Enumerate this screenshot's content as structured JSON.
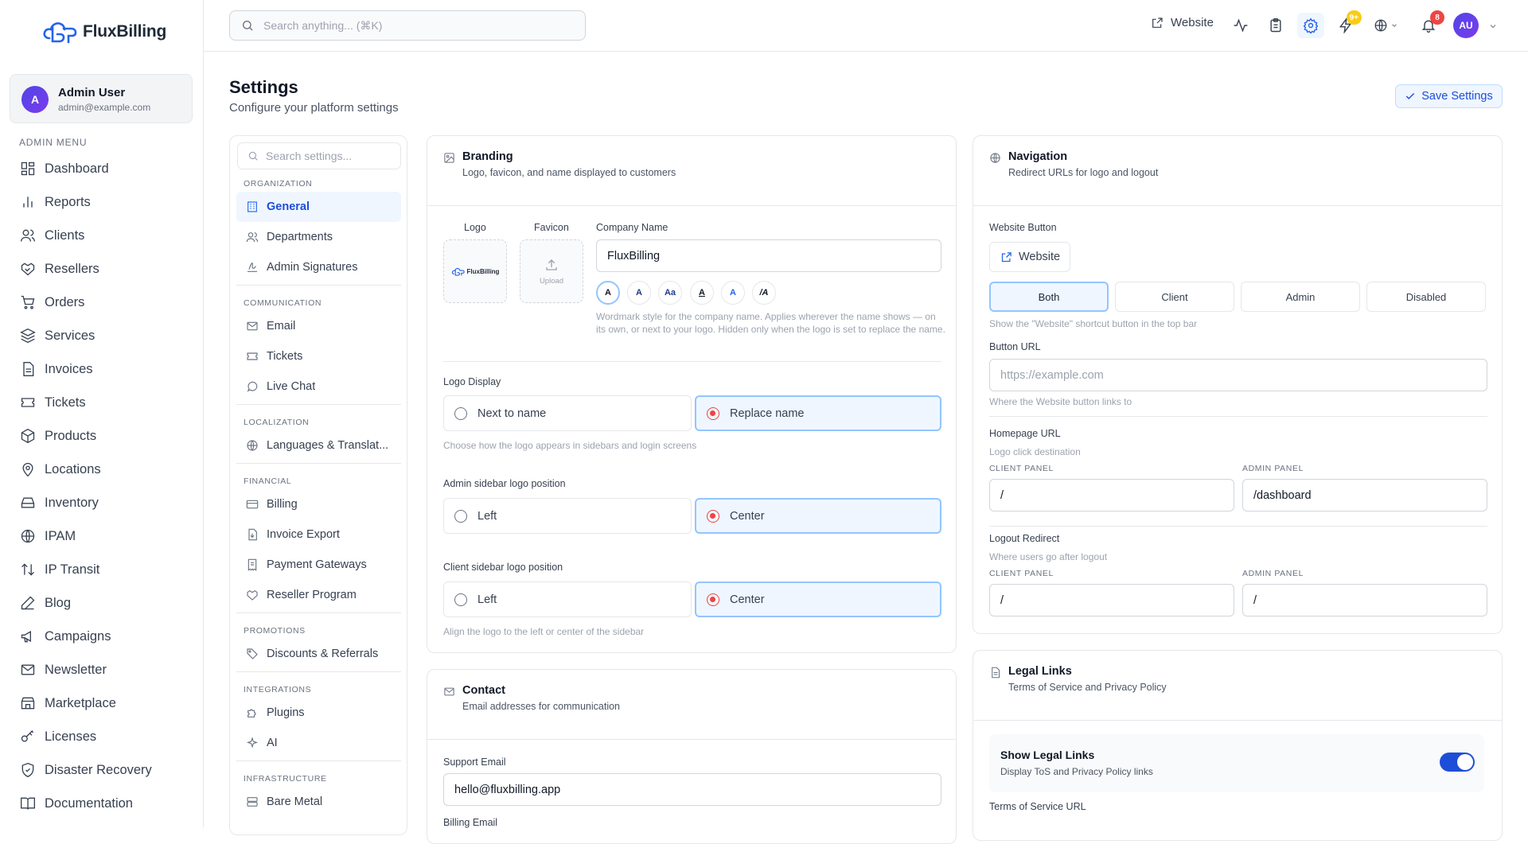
{
  "brand": {
    "name": "FluxBilling"
  },
  "user": {
    "initial": "A",
    "name": "Admin User",
    "email": "admin@example.com"
  },
  "menu": {
    "heading": "ADMIN MENU",
    "items": [
      {
        "label": "Dashboard",
        "icon": "dashboard-icon"
      },
      {
        "label": "Reports",
        "icon": "bar-chart-icon"
      },
      {
        "label": "Clients",
        "icon": "users-icon"
      },
      {
        "label": "Resellers",
        "icon": "handshake-icon"
      },
      {
        "label": "Orders",
        "icon": "cart-icon"
      },
      {
        "label": "Services",
        "icon": "layers-icon"
      },
      {
        "label": "Invoices",
        "icon": "file-icon"
      },
      {
        "label": "Tickets",
        "icon": "ticket-icon"
      },
      {
        "label": "Products",
        "icon": "box-icon"
      },
      {
        "label": "Locations",
        "icon": "map-pin-icon"
      },
      {
        "label": "Inventory",
        "icon": "hard-drive-icon"
      },
      {
        "label": "IPAM",
        "icon": "globe-icon"
      },
      {
        "label": "IP Transit",
        "icon": "arrows-updown-icon"
      },
      {
        "label": "Blog",
        "icon": "pen-icon"
      },
      {
        "label": "Campaigns",
        "icon": "megaphone-icon"
      },
      {
        "label": "Newsletter",
        "icon": "mail-icon"
      },
      {
        "label": "Marketplace",
        "icon": "store-icon"
      },
      {
        "label": "Licenses",
        "icon": "key-icon"
      },
      {
        "label": "Disaster Recovery",
        "icon": "shield-icon"
      },
      {
        "label": "Documentation",
        "icon": "book-icon"
      }
    ]
  },
  "topbar": {
    "search_placeholder": "Search anything... (⌘K)",
    "website_label": "Website",
    "updates_badge": "9+",
    "notifications_badge": "8",
    "avatar_initials": "AU"
  },
  "page": {
    "title": "Settings",
    "subtitle": "Configure your platform settings",
    "save_label": "Save Settings"
  },
  "settings_nav": {
    "search_placeholder": "Search settings...",
    "groups": [
      {
        "title": "ORGANIZATION",
        "items": [
          {
            "label": "General",
            "active": true
          },
          {
            "label": "Departments"
          },
          {
            "label": "Admin Signatures"
          }
        ]
      },
      {
        "title": "COMMUNICATION",
        "items": [
          {
            "label": "Email"
          },
          {
            "label": "Tickets"
          },
          {
            "label": "Live Chat"
          }
        ]
      },
      {
        "title": "LOCALIZATION",
        "items": [
          {
            "label": "Languages & Translat..."
          }
        ]
      },
      {
        "title": "FINANCIAL",
        "items": [
          {
            "label": "Billing"
          },
          {
            "label": "Invoice Export"
          },
          {
            "label": "Payment Gateways"
          },
          {
            "label": "Reseller Program"
          }
        ]
      },
      {
        "title": "PROMOTIONS",
        "items": [
          {
            "label": "Discounts & Referrals"
          }
        ]
      },
      {
        "title": "INTEGRATIONS",
        "items": [
          {
            "label": "Plugins"
          },
          {
            "label": "AI"
          }
        ]
      },
      {
        "title": "INFRASTRUCTURE",
        "items": [
          {
            "label": "Bare Metal"
          }
        ]
      }
    ]
  },
  "branding": {
    "title": "Branding",
    "description": "Logo, favicon, and name displayed to customers",
    "logo_label": "Logo",
    "logo_preview_text": "FluxBilling",
    "favicon_label": "Favicon",
    "upload_label": "Upload",
    "company_name_label": "Company Name",
    "company_name_value": "FluxBilling",
    "wordmark_styles": [
      "A",
      "A",
      "Aa",
      "A",
      "A",
      "/A"
    ],
    "wordmark_hint": "Wordmark style for the company name. Applies wherever the name shows — on its own, or next to your logo. Hidden only when the logo is set to replace the name.",
    "logo_display_label": "Logo Display",
    "logo_display_options": [
      "Next to name",
      "Replace name"
    ],
    "logo_display_hint": "Choose how the logo appears in sidebars and login screens",
    "admin_sidebar_label": "Admin sidebar logo position",
    "client_sidebar_label": "Client sidebar logo position",
    "position_options": [
      "Left",
      "Center"
    ],
    "position_hint": "Align the logo to the left or center of the sidebar"
  },
  "contact": {
    "title": "Contact",
    "description": "Email addresses for communication",
    "support_label": "Support Email",
    "support_value": "hello@fluxbilling.app",
    "billing_label": "Billing Email"
  },
  "navigation": {
    "title": "Navigation",
    "description": "Redirect URLs for logo and logout",
    "website_button_label": "Website Button",
    "website_button_text": "Website",
    "visibility_options": [
      "Both",
      "Client",
      "Admin",
      "Disabled"
    ],
    "visibility_hint": "Show the \"Website\" shortcut button in the top bar",
    "button_url_label": "Button URL",
    "button_url_placeholder": "https://example.com",
    "button_url_hint": "Where the Website button links to",
    "homepage_label": "Homepage URL",
    "homepage_hint": "Logo click destination",
    "client_panel_label": "CLIENT PANEL",
    "admin_panel_label": "ADMIN PANEL",
    "homepage_client_value": "/",
    "homepage_admin_value": "/dashboard",
    "logout_label": "Logout Redirect",
    "logout_hint": "Where users go after logout",
    "logout_client_value": "/",
    "logout_admin_value": "/"
  },
  "legal": {
    "title": "Legal Links",
    "description": "Terms of Service and Privacy Policy",
    "toggle_title": "Show Legal Links",
    "toggle_desc": "Display ToS and Privacy Policy links",
    "toggle_on": true,
    "tos_label": "Terms of Service URL"
  },
  "colors": {
    "accent": "#1d4ed8",
    "radio_selected": "#ef4444",
    "active_bg": "#eff6ff"
  }
}
